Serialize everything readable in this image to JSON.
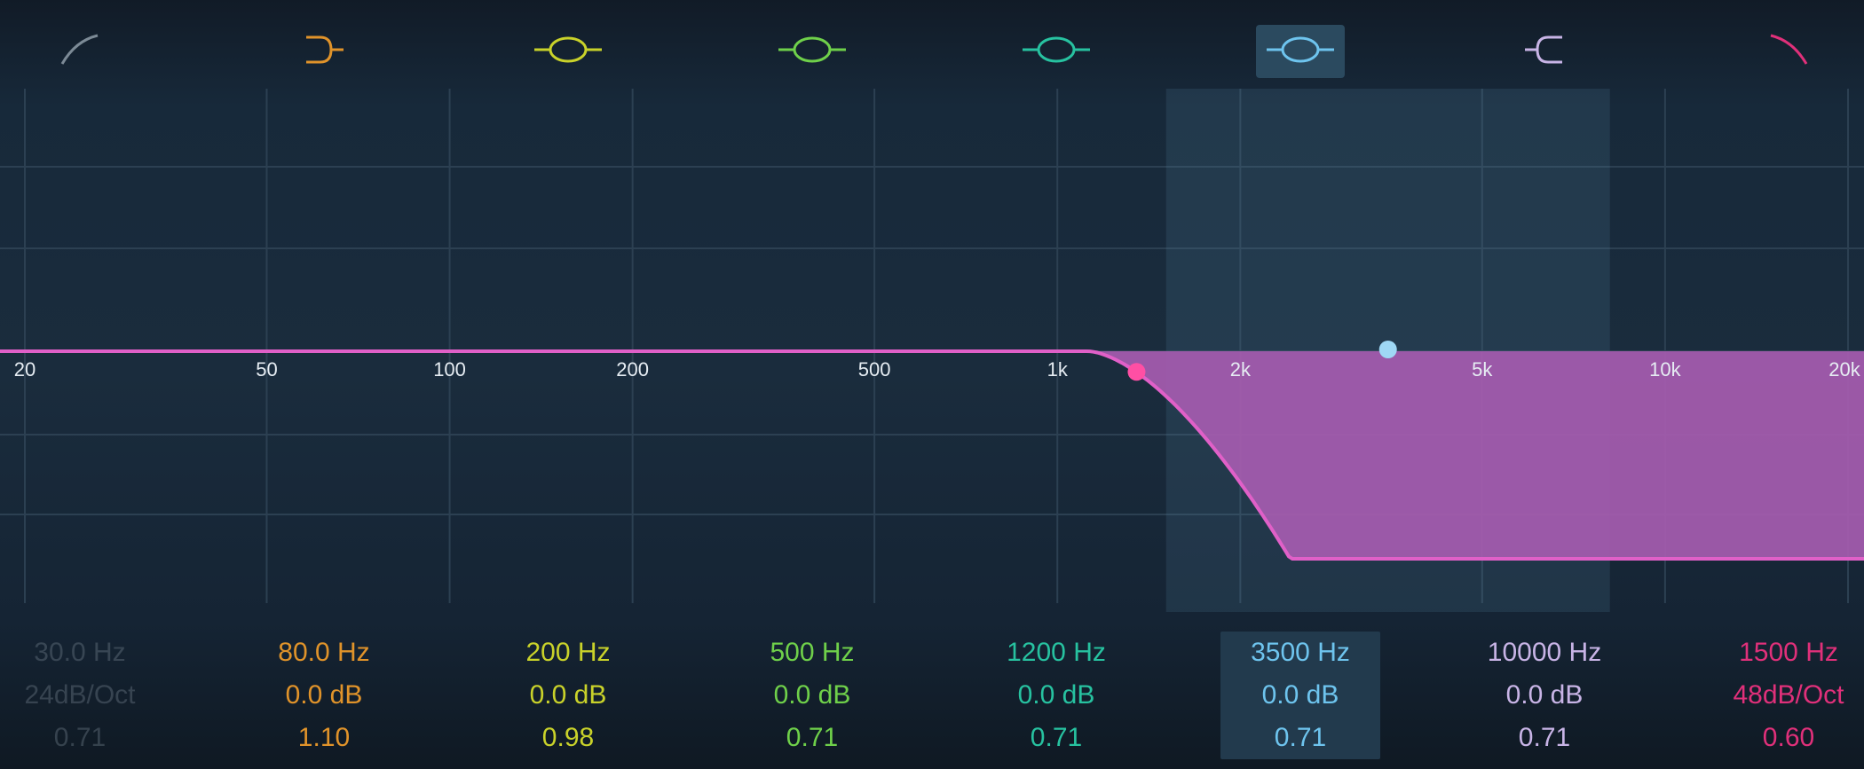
{
  "colors": {
    "background": "#15212f",
    "grid": "#2c4052",
    "curve": "#e060c8",
    "fill": "#a65cb0",
    "selected_highlight": "#2b4a5f",
    "selected_node": "#9fd8f5",
    "lowcut_node": "#ff4fa4"
  },
  "freq_axis": {
    "labels": [
      "20",
      "50",
      "100",
      "200",
      "500",
      "1k",
      "2k",
      "5k",
      "10k",
      "20k"
    ],
    "values": [
      20,
      50,
      100,
      200,
      500,
      1000,
      2000,
      5000,
      10000,
      20000
    ]
  },
  "bands": [
    {
      "type": "high-pass",
      "icon": "highpass-filter-icon",
      "color": "#7c8a96",
      "freq": "30.0 Hz",
      "gain": "24dB/Oct",
      "q": "0.71",
      "selected": false,
      "active": false
    },
    {
      "type": "low-shelf",
      "icon": "low-shelf-icon",
      "color": "#e0932a",
      "freq": "80.0 Hz",
      "gain": "0.0 dB",
      "q": "1.10",
      "selected": false,
      "active": true
    },
    {
      "type": "bell",
      "icon": "bell-icon",
      "color": "#c9d22a",
      "freq": "200 Hz",
      "gain": "0.0 dB",
      "q": "0.98",
      "selected": false,
      "active": true
    },
    {
      "type": "bell",
      "icon": "bell-icon",
      "color": "#6fd04a",
      "freq": "500 Hz",
      "gain": "0.0 dB",
      "q": "0.71",
      "selected": false,
      "active": true
    },
    {
      "type": "bell",
      "icon": "bell-icon",
      "color": "#27c2a0",
      "freq": "1200 Hz",
      "gain": "0.0 dB",
      "q": "0.71",
      "selected": false,
      "active": true
    },
    {
      "type": "bell",
      "icon": "bell-icon",
      "color": "#6ec4ee",
      "freq": "3500 Hz",
      "gain": "0.0 dB",
      "q": "0.71",
      "selected": true,
      "active": true
    },
    {
      "type": "high-shelf",
      "icon": "high-shelf-icon",
      "color": "#c8b4e6",
      "freq": "10000 Hz",
      "gain": "0.0 dB",
      "q": "0.71",
      "selected": false,
      "active": true
    },
    {
      "type": "low-pass",
      "icon": "lowpass-filter-icon",
      "color": "#e0307a",
      "freq": "1500 Hz",
      "gain": "48dB/Oct",
      "q": "0.60",
      "selected": false,
      "active": true
    }
  ],
  "response": {
    "lowpass_cutoff_hz": 1500,
    "selected_node_freq_hz": 3500,
    "gain_db": 0
  }
}
